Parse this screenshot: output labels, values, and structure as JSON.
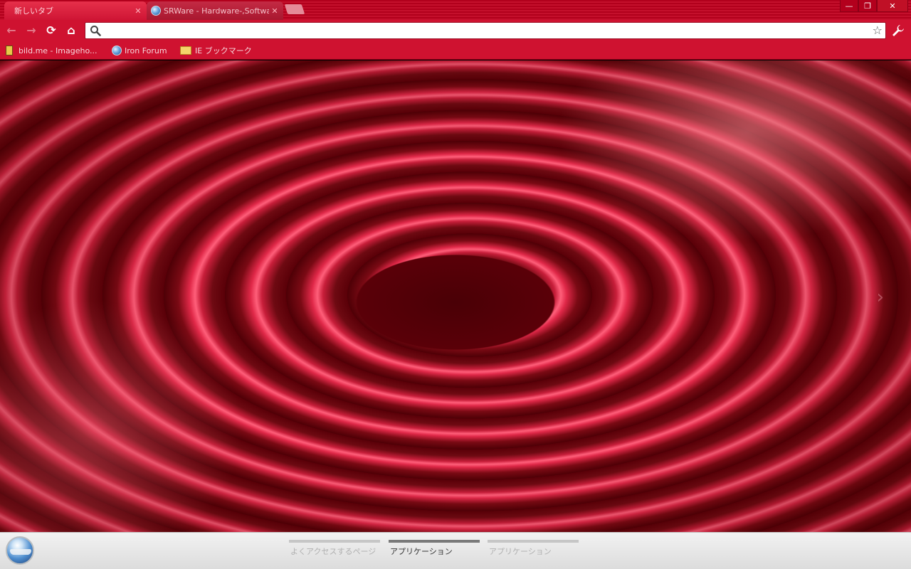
{
  "tabs": [
    {
      "title": "新しいタブ",
      "active": true
    },
    {
      "title": "SRWare - Hardware-,Software",
      "active": false
    }
  ],
  "window_controls": {
    "minimize": "—",
    "restore": "❐",
    "close": "✕"
  },
  "toolbar": {
    "back": "←",
    "forward": "→",
    "reload": "⟳",
    "home": "⌂",
    "omnibox_value": "",
    "star": "☆"
  },
  "bookmarks": [
    {
      "label": "bild.me - Imageho..."
    },
    {
      "label": "Iron Forum"
    },
    {
      "label": "IE ブックマーク"
    }
  ],
  "content": {
    "next_arrow": "›"
  },
  "footer": {
    "page_tabs": [
      {
        "label": "よくアクセスするページ",
        "selected": false
      },
      {
        "label": "アプリケーション",
        "selected": true
      },
      {
        "label": "アプリケーション",
        "selected": false
      }
    ]
  },
  "colors": {
    "frame": "#b2001c",
    "toolbar": "#cf1230",
    "footer": "#e6e6e6"
  }
}
